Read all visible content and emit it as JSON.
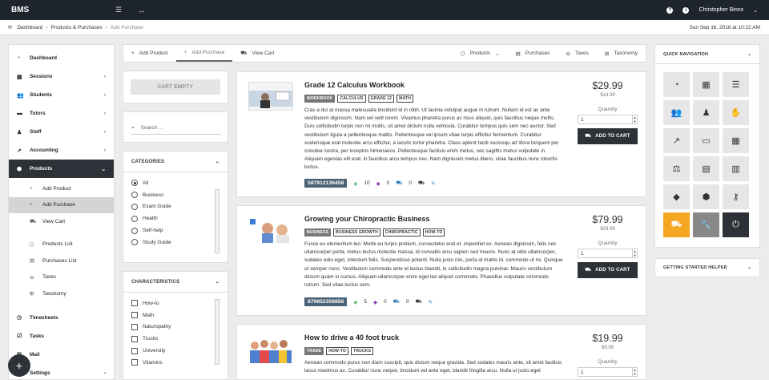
{
  "app": {
    "brand": "BMS",
    "menu_icon": "hamburger-icon",
    "expand_icon": "expand-arrows-icon",
    "user": "Christopher Binns"
  },
  "breadcrumb": {
    "items": [
      "Dashboard",
      "Products & Purchases"
    ],
    "current": "Add Purchase",
    "datetime": "Sun Sep 16, 2018 at 10:22 AM"
  },
  "sidebar": {
    "items": [
      {
        "label": "Dashboard",
        "icon": "gauge-icon",
        "chev": false
      },
      {
        "label": "Sessions",
        "icon": "calendar-icon",
        "chev": true
      },
      {
        "label": "Students",
        "icon": "users-icon",
        "chev": true
      },
      {
        "label": "Tutors",
        "icon": "tutors-icon",
        "chev": true
      },
      {
        "label": "Staff",
        "icon": "staff-icon",
        "chev": true
      },
      {
        "label": "Accounting",
        "icon": "chart-icon",
        "chev": true
      },
      {
        "label": "Products",
        "icon": "box-icon",
        "chev": true,
        "active": true
      }
    ],
    "sub": [
      {
        "label": "Add Product",
        "icon": "plus-icon"
      },
      {
        "label": "Add Purchase",
        "icon": "plus-icon",
        "selected": true
      },
      {
        "label": "View Cart",
        "icon": "cart-icon"
      }
    ],
    "sub2": [
      {
        "label": "Products List",
        "icon": "box-icon"
      },
      {
        "label": "Purchases List",
        "icon": "list-icon"
      },
      {
        "label": "Taxes",
        "icon": "minus-circle-icon"
      },
      {
        "label": "Taxonomy",
        "icon": "sitemap-icon"
      }
    ],
    "bottom": [
      {
        "label": "Timesheets",
        "icon": "clock-icon"
      },
      {
        "label": "Tasks",
        "icon": "tasks-icon"
      },
      {
        "label": "Mail",
        "icon": "mail-icon"
      },
      {
        "label": "Settings",
        "icon": "gear-icon",
        "chev": true
      }
    ]
  },
  "tabs": {
    "left": [
      "Add Product",
      "Add Purchase",
      "View Cart"
    ],
    "right": [
      "Products",
      "Purchases",
      "Taxes",
      "Taxonomy"
    ]
  },
  "cart": {
    "label": "CART EMPTY"
  },
  "search": {
    "label": "Search ..."
  },
  "categories": {
    "title": "CATEGORIES",
    "options": [
      "All",
      "Business",
      "Exam Guide",
      "Health",
      "Self-help",
      "Study Guide"
    ],
    "selected": "All"
  },
  "characteristics": {
    "title": "CHARACTERISTICS",
    "options": [
      "How-to",
      "Math",
      "Naturopathy",
      "Trucks",
      "University",
      "Vitamins"
    ]
  },
  "products": [
    {
      "title": "Grade 12 Calculus Workbook",
      "type_tag": "WORKBOOK",
      "tags": [
        "CALCULUS",
        "GRADE 12",
        "MATH"
      ],
      "description": "Cras a dui at massa malesuada tincidunt id in nibh. Ut lacinia volutpat augue in rutrum. Nullam id est ac ante vestibulum dignissim. Nam vel velit lorem. Vivamus pharetra purus ac risus aliquet, quis faucibus neque mollis. Duis sollicitudin turpis non mi mollis, sit amet dictum nulla vehicula. Curabitur tempus quis sem nec auctor. Sed vestibulum ligula a pellentesque mattis. Pellentesque vel ipsum vitae turpis efficitur fermentum. Curabitur scelerisque erat molestie arcu efficitur, a iaculis tortor pharetra. Class aptent taciti sociosqu ad litora torquent per conubia nostra, per inceptos himenaeos. Pellentesque facilisis enim metus, nec sagittis metus vulputate in. Aliquam egestas elit erat, in faucibus arcu tempus nec. Nam dignissim metus libero, vitae faucibus nunc lobortis luctus.",
      "isbn": "587912136458",
      "stock": "10",
      "tagcount": "0",
      "carts": "0",
      "price": "$29.99",
      "cost": "$14.99",
      "qty_label": "Quantity",
      "qty": "1",
      "cart_btn": "ADD TO CART"
    },
    {
      "title": "Growing your Chiropractic Business",
      "type_tag": "BUSINESS",
      "tags": [
        "BUSINESS GROWTH",
        "CHIROPRACTIC",
        "HOW-TO"
      ],
      "description": "Fusce eu elementum leo. Morbi eu turpis pretium, consectetur erat et, imperdiet ex. Aenean dignissim, felis nec ullamcorper porta, metus lectus molestie massa, id convallis arcu sapien sed mauris. Nunc at odio ullamcorper, sodales odio eget, interdum felis. Suspendisse potenti. Nulla justo nisi, porta id mattis id, commodo ut mi. Quisque ut semper nunc. Vestibulum commodo ante et lectus blandit, in sollicitudin magna pulvinar. Mauris vestibulum dictum quam in cursus. Aliquam ullamcorper enim eget leo aliquet commodo. Phasellus vulputate commodo rutrum. Sed vitae luctus sem.",
      "isbn": "879852359856",
      "stock": "5",
      "tagcount": "0",
      "carts": "0",
      "price": "$79.99",
      "cost": "$29.99",
      "qty_label": "Quantity",
      "qty": "1",
      "cart_btn": "ADD TO CART"
    },
    {
      "title": "How to drive a 40 foot truck",
      "type_tag": "TRADE",
      "tags": [
        "HOW-TO",
        "TRUCKS"
      ],
      "description": "Aenean commodo purus non diam suscipit, quis dictum neque gravida. Sed sodales mauris ante, sit amet facilisis lacus maximus ac. Curabitur nunc neque, tincidunt vel ante eget, blandit fringilla arcu. Nulla ut justo eget",
      "price": "$19.99",
      "cost": "$9.99",
      "qty_label": "Quantity",
      "qty": "1"
    }
  ],
  "quicknav": {
    "title": "QUICK NAVIGATION",
    "icons": [
      "gauge-icon",
      "calendar-icon",
      "list-icon",
      "users-icon",
      "staff-icon",
      "hand-icon",
      "chart-line-icon",
      "card-icon",
      "grid-icon",
      "scale-icon",
      "document-icon",
      "bar-chart-icon",
      "tags-icon",
      "box-icon",
      "key-icon",
      "cart-icon",
      "wrench-icon",
      "power-icon"
    ]
  },
  "helper": {
    "title": "GETTING STARTED HELPER"
  }
}
